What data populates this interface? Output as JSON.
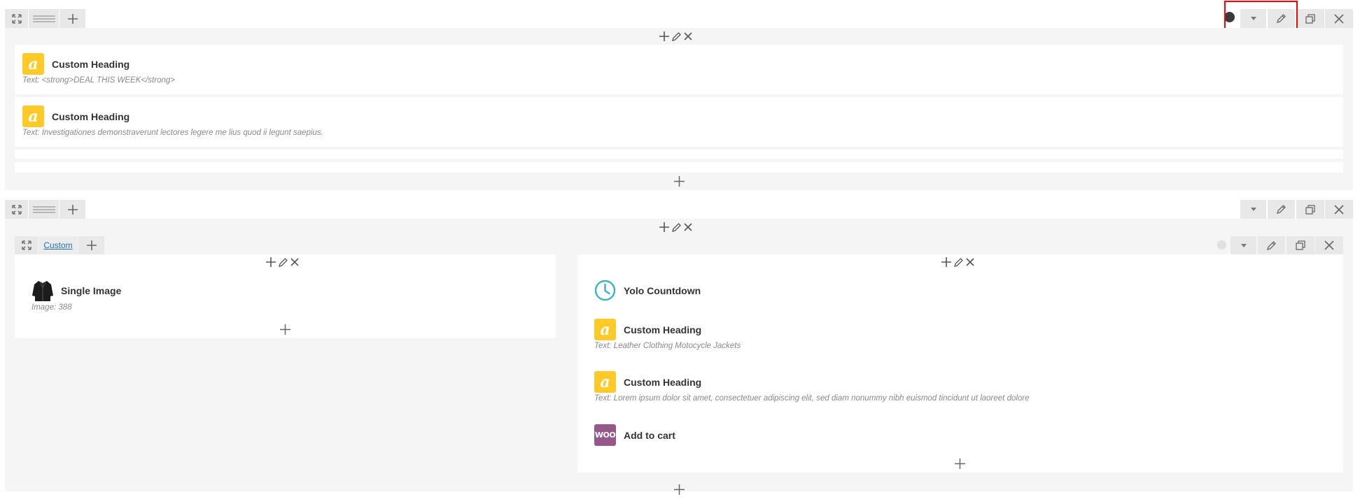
{
  "icons": {
    "expand": "expand-icon",
    "drag": "drag-handle-icon",
    "add": "plus-icon",
    "edit": "pencil-icon",
    "close": "close-icon",
    "clone": "clone-icon",
    "toggle": "caret-down-icon",
    "color": "color-dot-icon",
    "countdown": "clock-icon"
  },
  "colors": {
    "heading_icon": "#ffc928",
    "woo_icon": "#96588a",
    "countdown_icon": "#35b5c7",
    "highlight": "#ff0000",
    "link": "#2271b1"
  },
  "row1": {
    "elements": [
      {
        "title": "Custom Heading",
        "subtitle": "Text: <strong>DEAL THIS WEEK</strong>"
      },
      {
        "title": "Custom Heading",
        "subtitle": "Text: Investigationes demonstraverunt lectores legere me lius quod ii legunt saepius."
      }
    ]
  },
  "row2": {
    "inner_row": {
      "tab_label": "Custom",
      "left_column": {
        "elements": [
          {
            "title": "Single Image",
            "subtitle": "Image: 388"
          }
        ]
      },
      "right_column": {
        "elements": [
          {
            "title": "Yolo Countdown"
          },
          {
            "title": "Custom Heading",
            "subtitle": "Text: Leather Clothing Motocycle Jackets"
          },
          {
            "title": "Custom Heading",
            "subtitle": "Text: Lorem ipsum dolor sit amet, consectetuer adipiscing elit, sed diam nonummy nibh euismod tincidunt ut laoreet dolore"
          },
          {
            "title": "Add to cart"
          }
        ]
      }
    }
  },
  "woo_icon_text": "WOO"
}
